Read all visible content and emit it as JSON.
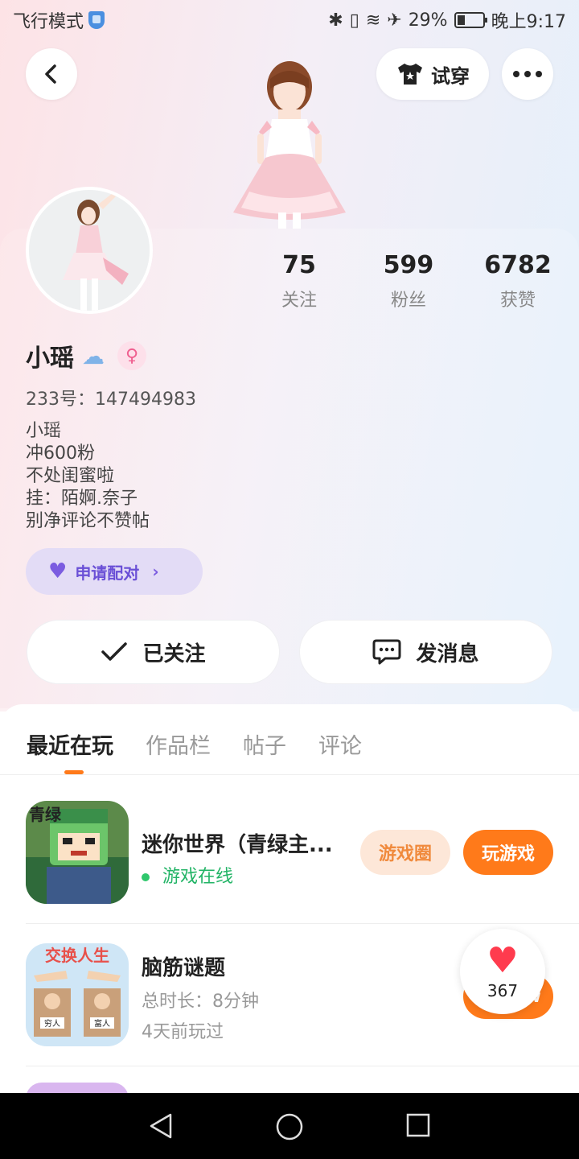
{
  "status_bar": {
    "mode": "飞行模式",
    "battery_percent": "29%",
    "battery_level": 0.29,
    "time": "晚上9:17"
  },
  "header": {
    "back_icon": "chevron-left-icon",
    "tryon_label": "试穿",
    "more_icon": "more-dots-icon"
  },
  "profile": {
    "stats": [
      {
        "value": "75",
        "label": "关注"
      },
      {
        "value": "599",
        "label": "粉丝"
      },
      {
        "value": "6782",
        "label": "获赞"
      }
    ],
    "name": "小瑶",
    "gender_icon": "♀",
    "uid": "233号：147494983",
    "bio": [
      "小瑶",
      "冲600粉",
      "不处闺蜜啦",
      "挂：陌婀.奈子",
      "别净评论不赞帖"
    ],
    "pair_label": "申请配对",
    "follow_label": "已关注",
    "message_label": "发消息"
  },
  "tabs": [
    "最近在玩",
    "作品栏",
    "帖子",
    "评论"
  ],
  "games": [
    {
      "title": "迷你世界（青绿主...",
      "status": "游戏在线",
      "circle_label": "游戏圈",
      "play_label": "玩游戏"
    },
    {
      "title": "脑筋谜题",
      "duration": "总时长：8分钟",
      "last_played": "4天前玩过",
      "icon_text": "交换人生",
      "icon_labels": [
        "穷人",
        "富人"
      ]
    }
  ],
  "like_bubble": {
    "count": "367"
  },
  "colors": {
    "accent": "#ff7a1a",
    "pair": "#6a4fd6",
    "online": "#22b466"
  }
}
